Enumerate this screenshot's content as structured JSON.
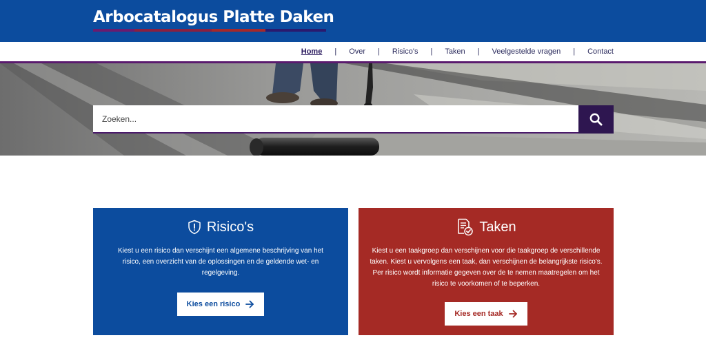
{
  "brand": {
    "title": "Arbocatalogus Platte Daken",
    "underline_colors": [
      "#6a1c6e",
      "#8a2040",
      "#a5282a",
      "#2a1a6e"
    ]
  },
  "nav": {
    "items": [
      {
        "label": "Home",
        "active": true
      },
      {
        "label": "Over"
      },
      {
        "label": "Risico's"
      },
      {
        "label": "Taken"
      },
      {
        "label": "Veelgestelde vragen"
      },
      {
        "label": "Contact"
      }
    ],
    "separator": "|"
  },
  "hero": {
    "image_description_icon": "roofing-worker-photo"
  },
  "search": {
    "placeholder": "Zoeken...",
    "button_icon": "search-icon"
  },
  "cards": {
    "risico": {
      "icon": "shield-alert-icon",
      "title": "Risico's",
      "text": "Kiest u een risico dan verschijnt een algemene beschrijving van het risico, een overzicht van de oplossingen en de geldende wet- en regelgeving.",
      "button": "Kies een risico",
      "color": "#0c4c9e"
    },
    "taken": {
      "icon": "document-check-icon",
      "title": "Taken",
      "text": "Kiest u een taakgroep dan verschijnen voor die taakgroep de verschillende taken. Kiest u vervolgens een taak, dan verschijnen de belangrijkste risico's. Per risico wordt informatie gegeven over de te nemen maatregelen om het risico te voorkomen of te beperken.",
      "button": "Kies een taak",
      "color": "#a52a25"
    }
  }
}
